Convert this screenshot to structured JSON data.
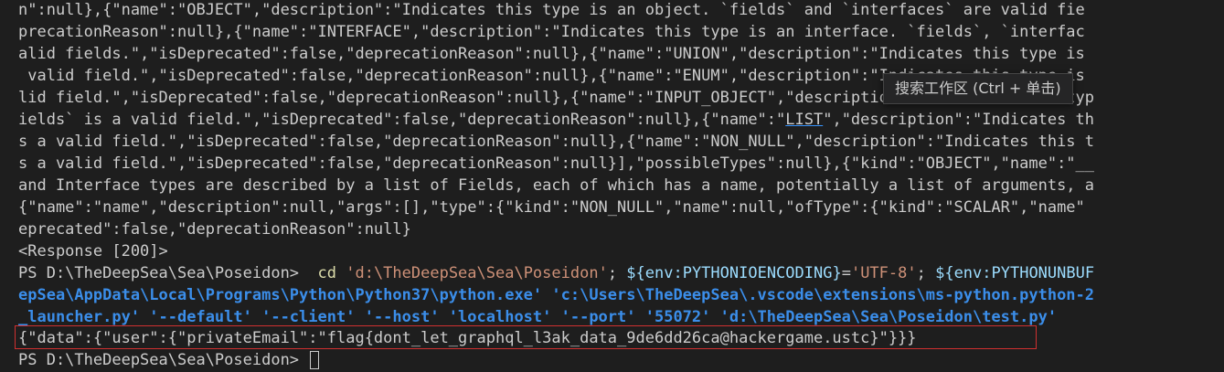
{
  "terminal": {
    "output_lines": [
      "n\":null},{\"name\":\"OBJECT\",\"description\":\"Indicates this type is an object. `fields` and `interfaces` are valid fie",
      "precationReason\":null},{\"name\":\"INTERFACE\",\"description\":\"Indicates this type is an interface. `fields`, `interfac",
      "alid fields.\",\"isDeprecated\":false,\"deprecationReason\":null},{\"name\":\"UNION\",\"description\":\"Indicates this type is",
      " valid field.\",\"isDeprecated\":false,\"deprecationReason\":null},{\"name\":\"ENUM\",\"description\":\"Indicates this type is",
      "lid field.\",\"isDeprecated\":false,\"deprecationReason\":null},{\"name\":\"INPUT_OBJECT\",\"description\":\"Indicates this typ",
      "ields` is a valid field.\",\"isDeprecated\":false,\"deprecationReason\":null},{\"name\":\"LIST\",\"description\":\"Indicates th",
      "s a valid field.\",\"isDeprecated\":false,\"deprecationReason\":null},{\"name\":\"NON_NULL\",\"description\":\"Indicates this t",
      "s a valid field.\",\"isDeprecated\":false,\"deprecationReason\":null}],\"possibleTypes\":null},{\"kind\":\"OBJECT\",\"name\":\"__",
      "and Interface types are described by a list of Fields, each of which has a name, potentially a list of arguments, a",
      "{\"name\":\"name\",\"description\":null,\"args\":[],\"type\":{\"kind\":\"NON_NULL\",\"name\":null,\"ofType\":{\"kind\":\"SCALAR\",\"name\"",
      "eprecated\":false,\"deprecationReason\":null}",
      "<Response [200]>"
    ],
    "command": {
      "prompt": "PS D:\\TheDeepSea\\Sea\\Poseidon>  ",
      "cmd": "cd",
      "path_arg": " 'd:\\TheDeepSea\\Sea\\Poseidon'",
      "sep1": "; ",
      "env1": "${env:PYTHONIOENCODING}",
      "eq1": "=",
      "val1": "'UTF-8'",
      "sep2": "; ",
      "env2": "${env:PYTHONUNBUF",
      "line2": "epSea\\AppData\\Local\\Programs\\Python\\Python37\\python.exe' 'c:\\Users\\TheDeepSea\\.vscode\\extensions\\ms-python.python-2",
      "line3": "_launcher.py' '--default' '--client' '--host' 'localhost' '--port' '55072' 'd:\\TheDeepSea\\Sea\\Poseidon\\test.py'"
    },
    "result_line": "{\"data\":{\"user\":{\"privateEmail\":\"flag{dont_let_graphql_l3ak_data_9de6dd26ca@hackergame.ustc}\"}}}",
    "final_prompt": "PS D:\\TheDeepSea\\Sea\\Poseidon> ",
    "tooltip": "搜索工作区 (Ctrl + 单击)",
    "hovered_link_text": "LIST"
  }
}
